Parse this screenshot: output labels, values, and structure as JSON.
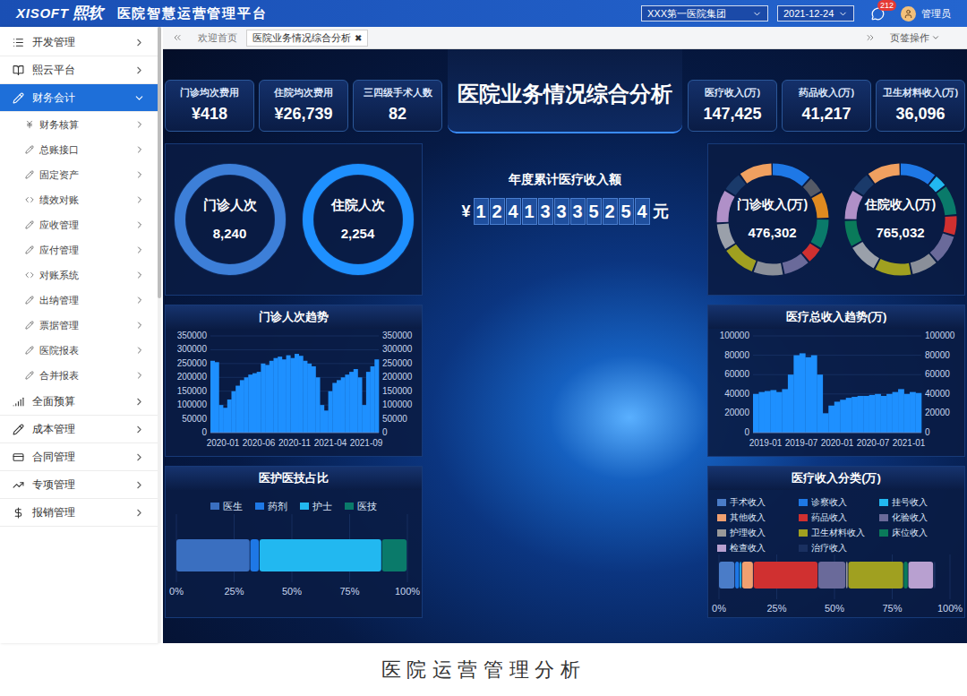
{
  "header": {
    "logo_latin": "XISOFT",
    "logo_cn": "熙软",
    "title": "医院智慧运营管理平台",
    "org_select": "XXX第一医院集团",
    "date_select": "2021-12-24",
    "message_badge": "212",
    "user": "管理员"
  },
  "sidebar": {
    "items": [
      {
        "label": "开发管理",
        "selected": false,
        "expanded": false,
        "children": []
      },
      {
        "label": "熙云平台",
        "selected": false,
        "expanded": false,
        "children": []
      },
      {
        "label": "财务会计",
        "selected": true,
        "expanded": true,
        "children": [
          "财务核算",
          "总账接口",
          "固定资产",
          "绩效对账",
          "应收管理",
          "应付管理",
          "对账系统",
          "出纳管理",
          "票据管理",
          "医院报表",
          "合并报表"
        ]
      },
      {
        "label": "全面预算",
        "selected": false,
        "expanded": false,
        "children": []
      },
      {
        "label": "成本管理",
        "selected": false,
        "expanded": false,
        "children": []
      },
      {
        "label": "合同管理",
        "selected": false,
        "expanded": false,
        "children": []
      },
      {
        "label": "专项管理",
        "selected": false,
        "expanded": false,
        "children": []
      },
      {
        "label": "报销管理",
        "selected": false,
        "expanded": false,
        "children": []
      }
    ],
    "scrollbar": {
      "level": 0.44
    }
  },
  "tabs": [
    {
      "label": "欢迎首页",
      "selected": false,
      "close": ""
    },
    {
      "label": "医院业务情况综合分析",
      "selected": true,
      "close": "✖"
    }
  ],
  "tab_menu": "页签操作",
  "dashboard": {
    "title": "医院业务情况综合分析",
    "kpis_left": [
      {
        "label": "门诊均次费用",
        "value": "¥418"
      },
      {
        "label": "住院均次费用",
        "value": "¥26,739"
      },
      {
        "label": "三四级手术人数",
        "value": "82"
      }
    ],
    "kpis_right": [
      {
        "label": "医疗收入(万)",
        "value": "147,425"
      },
      {
        "label": "药品收入(万)",
        "value": "41,217"
      },
      {
        "label": "卫生材料收入(万)",
        "value": "36,096"
      }
    ],
    "visit_donuts": [
      {
        "label": "门诊人次",
        "value": "8,240",
        "color": "#3d7fd8"
      },
      {
        "label": "住院人次",
        "value": "2,254",
        "color": "#1e90ff"
      }
    ],
    "counter": {
      "title": "年度累计医疗收入额",
      "prefix": "¥",
      "digits": [
        "1",
        "2",
        "4",
        "1",
        "3",
        "3",
        "3",
        "5",
        "2",
        "5",
        "4"
      ],
      "suffix": "元"
    },
    "income_donuts": [
      {
        "label": "门诊收入(万)",
        "value": "476,302",
        "segments": [
          {
            "value": 12,
            "color": "#1e78e6"
          },
          {
            "value": 5,
            "color": "#555a66"
          },
          {
            "value": 8,
            "color": "#e08a20"
          },
          {
            "value": 9,
            "color": "#0a7a6a"
          },
          {
            "value": 5,
            "color": "#d03030"
          },
          {
            "value": 8,
            "color": "#6a6a9a"
          },
          {
            "value": 9,
            "color": "#8a8f99"
          },
          {
            "value": 10,
            "color": "#a0a020"
          },
          {
            "value": 8,
            "color": "#9aa0aa"
          },
          {
            "value": 10,
            "color": "#b090c8"
          },
          {
            "value": 6,
            "color": "#1a3a6a"
          },
          {
            "value": 10,
            "color": "#f0a060"
          }
        ]
      },
      {
        "label": "住院收入(万)",
        "value": "765,032",
        "segments": [
          {
            "value": 11,
            "color": "#1e78e6"
          },
          {
            "value": 4,
            "color": "#22b8f0"
          },
          {
            "value": 9,
            "color": "#0a7a6a"
          },
          {
            "value": 6,
            "color": "#d03030"
          },
          {
            "value": 9,
            "color": "#6a6a9a"
          },
          {
            "value": 8,
            "color": "#8a8f99"
          },
          {
            "value": 11,
            "color": "#a0a020"
          },
          {
            "value": 9,
            "color": "#9aa0aa"
          },
          {
            "value": 8,
            "color": "#0a7a5a"
          },
          {
            "value": 9,
            "color": "#b090c8"
          },
          {
            "value": 6,
            "color": "#1a3a6a"
          },
          {
            "value": 10,
            "color": "#f0a060"
          }
        ]
      }
    ],
    "outpatient_trend": {
      "title": "门诊人次趋势",
      "y_ticks": [
        "350000",
        "300000",
        "250000",
        "200000",
        "150000",
        "100000",
        "50000",
        "0"
      ],
      "x_ticks": [
        "2020-01",
        "2020-06",
        "2020-11",
        "2021-04",
        "2021-09"
      ],
      "values": [
        260000,
        255000,
        100000,
        90000,
        120000,
        150000,
        170000,
        190000,
        200000,
        210000,
        215000,
        220000,
        250000,
        245000,
        260000,
        270000,
        275000,
        265000,
        280000,
        270000,
        285000,
        278000,
        260000,
        250000,
        240000,
        200000,
        100000,
        80000,
        150000,
        180000,
        190000,
        200000,
        210000,
        220000,
        230000,
        200000,
        100000,
        220000,
        240000,
        265000
      ]
    },
    "income_trend": {
      "title": "医疗总收入趋势(万)",
      "y_ticks": [
        "100000",
        "80000",
        "60000",
        "40000",
        "20000",
        "0"
      ],
      "x_ticks": [
        "2019-01",
        "2019-07",
        "2020-01",
        "2020-07",
        "2021-01"
      ],
      "values": [
        40000,
        42000,
        43000,
        44000,
        42000,
        45000,
        60000,
        80000,
        82000,
        78000,
        80000,
        60000,
        20000,
        28000,
        32000,
        34000,
        36000,
        37000,
        38000,
        38000,
        39000,
        40000,
        38000,
        40000,
        42000,
        45000,
        40000,
        42000,
        41000
      ]
    },
    "staff_share": {
      "title": "医护医技占比",
      "legend": [
        {
          "label": "医生",
          "value": 32,
          "color": "#3a6fc0"
        },
        {
          "label": "药剂",
          "value": 4,
          "color": "#1e78e6"
        },
        {
          "label": "护士",
          "value": 53,
          "color": "#22b8f0"
        },
        {
          "label": "医技",
          "value": 11,
          "color": "#0a7a6a"
        }
      ],
      "x_ticks": [
        "0%",
        "25%",
        "50%",
        "75%",
        "100%"
      ]
    },
    "income_share": {
      "title": "医疗收入分类(万)",
      "legend": [
        {
          "label": "手术收入",
          "value": 7,
          "color": "#4a7cc8"
        },
        {
          "label": "诊察收入",
          "value": 2,
          "color": "#1e78e6"
        },
        {
          "label": "挂号收入",
          "value": 1,
          "color": "#22b8f0"
        },
        {
          "label": "其他收入",
          "value": 5,
          "color": "#f0a070"
        },
        {
          "label": "药品收入",
          "value": 28,
          "color": "#d03030"
        },
        {
          "label": "化验收入",
          "value": 12,
          "color": "#6a6a9a"
        },
        {
          "label": "护理收入",
          "value": 1,
          "color": "#999999"
        },
        {
          "label": "卫生材料收入",
          "value": 24,
          "color": "#a0a020"
        },
        {
          "label": "床位收入",
          "value": 2,
          "color": "#0a7a5a"
        },
        {
          "label": "检查收入",
          "value": 11,
          "color": "#b8a0d0"
        },
        {
          "label": "治疗收入",
          "value": 1,
          "color": "#1a3060"
        }
      ],
      "x_ticks": [
        "0%",
        "25%",
        "50%",
        "75%",
        "100%"
      ]
    }
  },
  "caption": "医院运营管理分析"
}
